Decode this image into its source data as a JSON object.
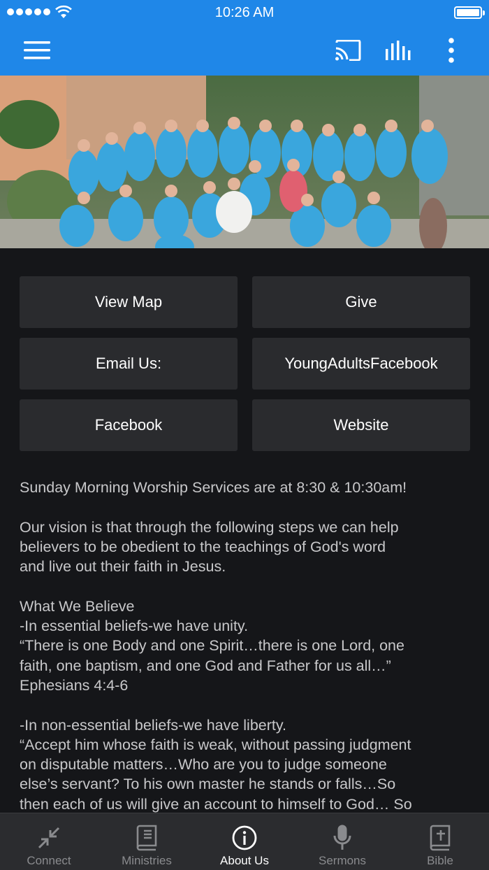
{
  "status_bar": {
    "time": "10:26 AM"
  },
  "toolbar": {
    "menu_icon": "hamburger-menu-icon",
    "cast_icon": "cast-icon",
    "audio_icon": "audio-bars-icon",
    "more_icon": "more-vertical-icon"
  },
  "hero": {
    "image": "group-photo-blue-shirts"
  },
  "buttons": [
    {
      "label": "View Map"
    },
    {
      "label": "Give"
    },
    {
      "label": "Email Us:"
    },
    {
      "label": "YoungAdultsFacebook"
    },
    {
      "label": "Facebook"
    },
    {
      "label": "Website"
    }
  ],
  "description": {
    "p1": "Sunday Morning Worship Services are at 8:30 & 10:30am!",
    "p2": "Our vision is that through the following steps we can help\nbelievers to be obedient to the teachings of God's word\nand live out their faith in Jesus.",
    "p3": "What We Believe\n-In essential beliefs-we have unity.\n“There is one Body and one Spirit…there is one Lord, one\nfaith, one baptism, and one God and Father for us all…”\nEphesians 4:4-6",
    "p4": "-In non-essential beliefs-we have liberty.\n“Accept him whose faith is weak, without passing judgment\non disputable matters…Who are you to judge someone\nelse’s servant?  To his own master he stands or falls…So\nthen each of us will give an account to himself to God… So"
  },
  "tabs": [
    {
      "label": "Connect",
      "icon": "collapse-arrows-icon",
      "active": false
    },
    {
      "label": "Ministries",
      "icon": "book-icon",
      "active": false
    },
    {
      "label": "About Us",
      "icon": "info-icon",
      "active": true
    },
    {
      "label": "Sermons",
      "icon": "microphone-icon",
      "active": false
    },
    {
      "label": "Bible",
      "icon": "bible-icon",
      "active": false
    }
  ],
  "colors": {
    "accent": "#1f87e8",
    "background": "#151619",
    "button": "#2a2b2e",
    "tabbar": "#2b2c2f"
  }
}
